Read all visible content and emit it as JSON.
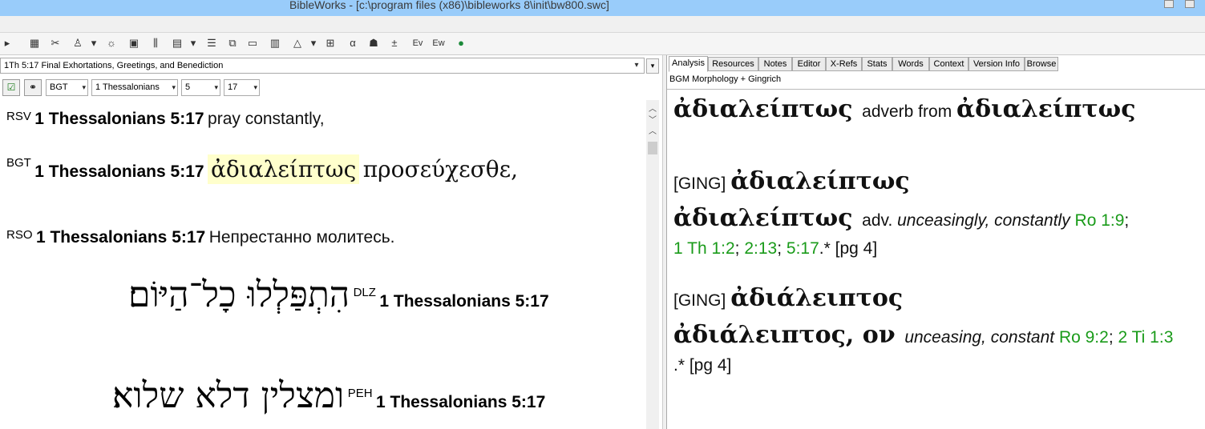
{
  "window": {
    "title": "BibleWorks - [c:\\program files (x86)\\bibleworks 8\\init\\bw800.swc]"
  },
  "toolbar": {
    "icons": [
      "search-icon",
      "database-icon",
      "tools-icon",
      "user-icon",
      "highlight-icon",
      "window-icon",
      "columns-icon",
      "layout-icon",
      "list-icon",
      "copy-icon",
      "folder-icon",
      "print-icon",
      "editor-icon",
      "compare-icon",
      "align-icon",
      "person-icon",
      "plus-icon",
      "ev-icon",
      "ew-icon",
      "globe-icon"
    ],
    "labels": [
      "±",
      "Ev",
      "Ew"
    ]
  },
  "left": {
    "reference_heading": "1Th 5:17 Final Exhortations, Greetings, and Benediction",
    "version_combo": "BGT",
    "book_combo": "1 Thessalonians",
    "chapter_combo": "5",
    "verse_combo": "17",
    "verses": [
      {
        "id": "RSV",
        "ref": "1 Thessalonians 5:17",
        "text": "pray constantly,"
      },
      {
        "id": "BGT",
        "ref": "1 Thessalonians 5:17",
        "highlight": "ἀδιαλείπτως",
        "text": "προσεύχεσθε,"
      },
      {
        "id": "RSO",
        "ref": "1 Thessalonians 5:17",
        "text": "Непрестанно молитесь."
      },
      {
        "id": "DLZ",
        "ref": "1 Thessalonians 5:17",
        "text": "הִתְפַּלְלוּ כָל־הַיּוֹם׃"
      },
      {
        "id": "PEH",
        "ref": "1 Thessalonians 5:17",
        "text": "ומצלין דלא שלוא׃"
      }
    ]
  },
  "right": {
    "tabs": [
      "Analysis",
      "Resources",
      "Notes",
      "Editor",
      "X-Refs",
      "Stats",
      "Words",
      "Context",
      "Version Info",
      "Browse"
    ],
    "active_tab": "Analysis",
    "subtitle": "BGM Morphology + Gingrich",
    "analysis": {
      "word": "ἀδιαλείπτως",
      "parse": "adverb from",
      "lemma": "ἀδιαλείπτως",
      "ging1_tag": "[GING]",
      "ging1_word": "ἀδιαλείπτως",
      "ging1_head": "ἀδιαλείπτως",
      "ging1_pos": "adv.",
      "ging1_def": "unceasingly, constantly",
      "ging1_ref1": "Ro 1:9",
      "ging1_sep1": ";",
      "ging1_ref2": "1 Th 1:2",
      "ging1_ref3": "2:13",
      "ging1_ref4": "5:17",
      "ging1_tail": ".* [pg 4]",
      "ging2_tag": "[GING]",
      "ging2_word": "ἀδιάλειπτος",
      "ging2_head": "ἀδιάλειπτος",
      "ging2_suffix": ", ον",
      "ging2_def": "unceasing, constant",
      "ging2_ref1": "Ro 9:2",
      "ging2_ref2": "2 Ti 1:3",
      "ging2_tail": ".* [pg 4]"
    }
  },
  "colors": {
    "titlebar": "#99ccfa",
    "highlight": "#ffffcc",
    "scripture_link": "#1a9b1a"
  }
}
